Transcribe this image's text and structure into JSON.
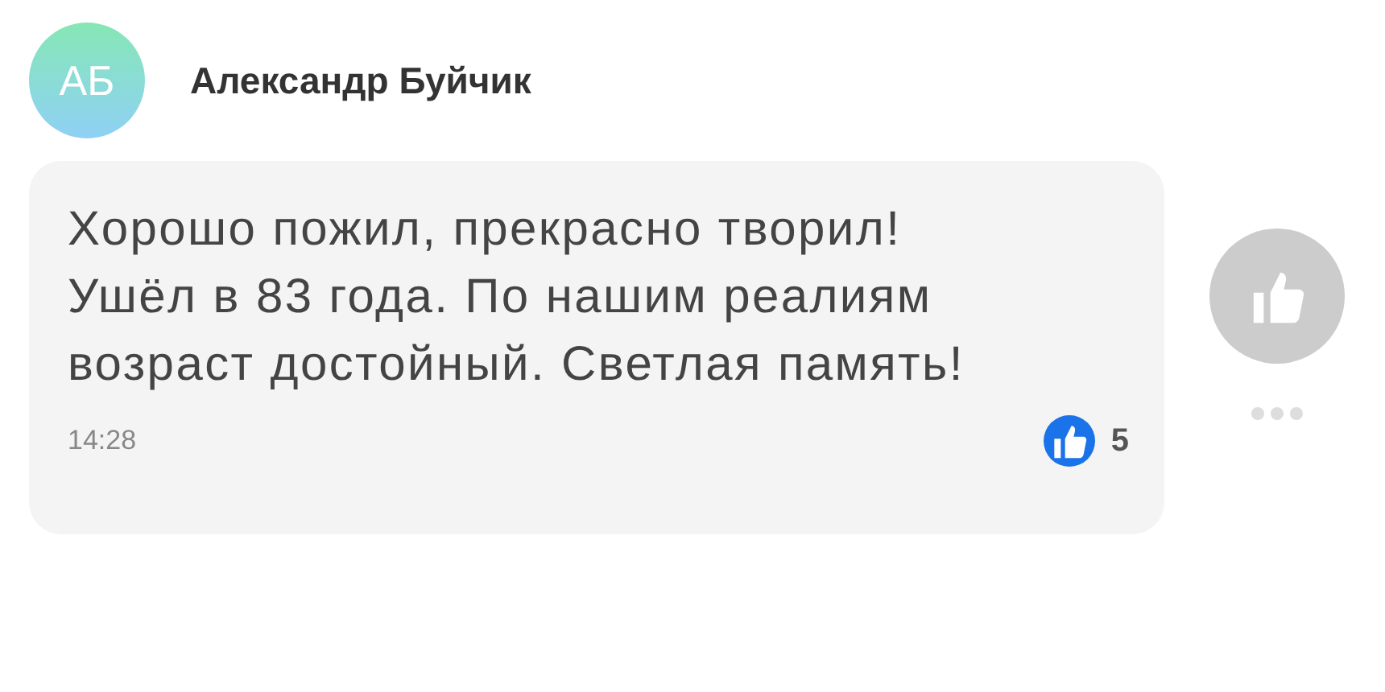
{
  "comment": {
    "avatar_initials": "АБ",
    "author": "Александр Буйчик",
    "text": "Хорошо пожил, прекрасно творил!\nУшёл в 83 года. По нашим реалиям\nвозраст достойный. Светлая память!",
    "time": "14:28",
    "likes": "5"
  },
  "like_button": {
    "liked": false
  }
}
